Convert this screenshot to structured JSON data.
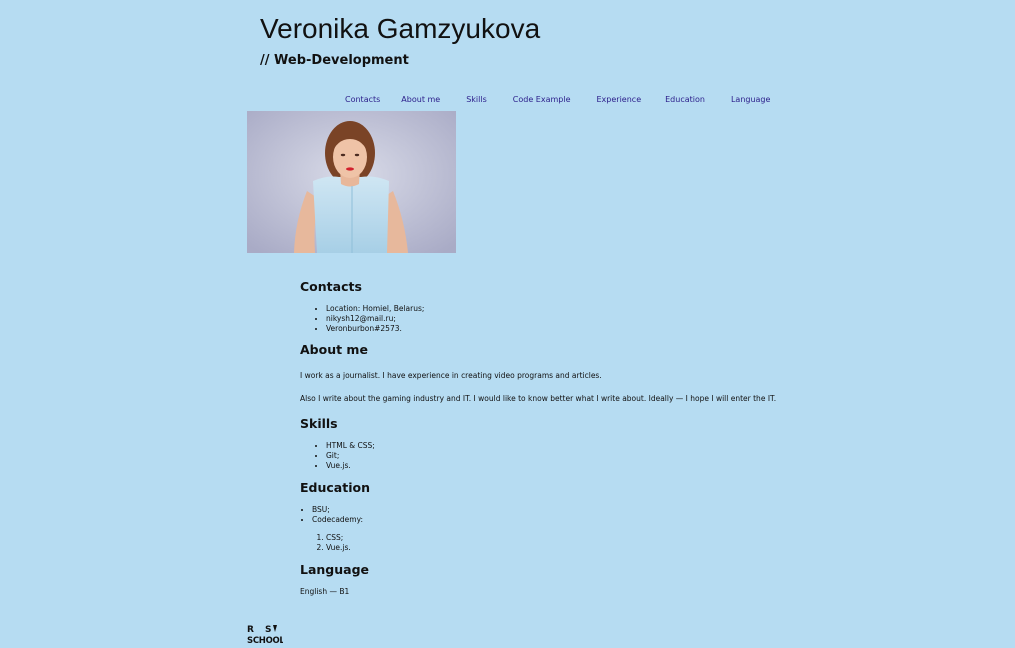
{
  "header": {
    "name": "Veronika Gamzyukova",
    "role": "// Web-Development"
  },
  "nav": {
    "items": [
      {
        "label": "Contacts"
      },
      {
        "label": "About me"
      },
      {
        "label": "Skills"
      },
      {
        "label": "Code Example"
      },
      {
        "label": "Experience"
      },
      {
        "label": "Education"
      },
      {
        "label": "Language"
      }
    ]
  },
  "contacts": {
    "heading": "Contacts",
    "items": [
      "Location: Homiel, Belarus;",
      "nikysh12@mail.ru;",
      "Veronburbon#2573."
    ]
  },
  "about": {
    "heading": "About me",
    "paragraphs": [
      "I work as a journalist. I have experience in creating video programs and articles.",
      "Also I write about the gaming industry and IT. I would like to know better what I write about. Ideally — I hope I will enter the IT."
    ]
  },
  "skills": {
    "heading": "Skills",
    "items": [
      "HTML & CSS;",
      "Git;",
      "Vue.js."
    ]
  },
  "education": {
    "heading": "Education",
    "items": [
      "BSU;",
      "Codecademy:"
    ],
    "courses": [
      "CSS;",
      "Vue.js."
    ]
  },
  "language": {
    "heading": "Language",
    "text": "English — B1"
  },
  "colors": {
    "background": "#b6dcf2",
    "nav_link": "#2b1d8a",
    "text": "#111111"
  },
  "footer": {
    "logo_text": "RS SCHOOL"
  }
}
